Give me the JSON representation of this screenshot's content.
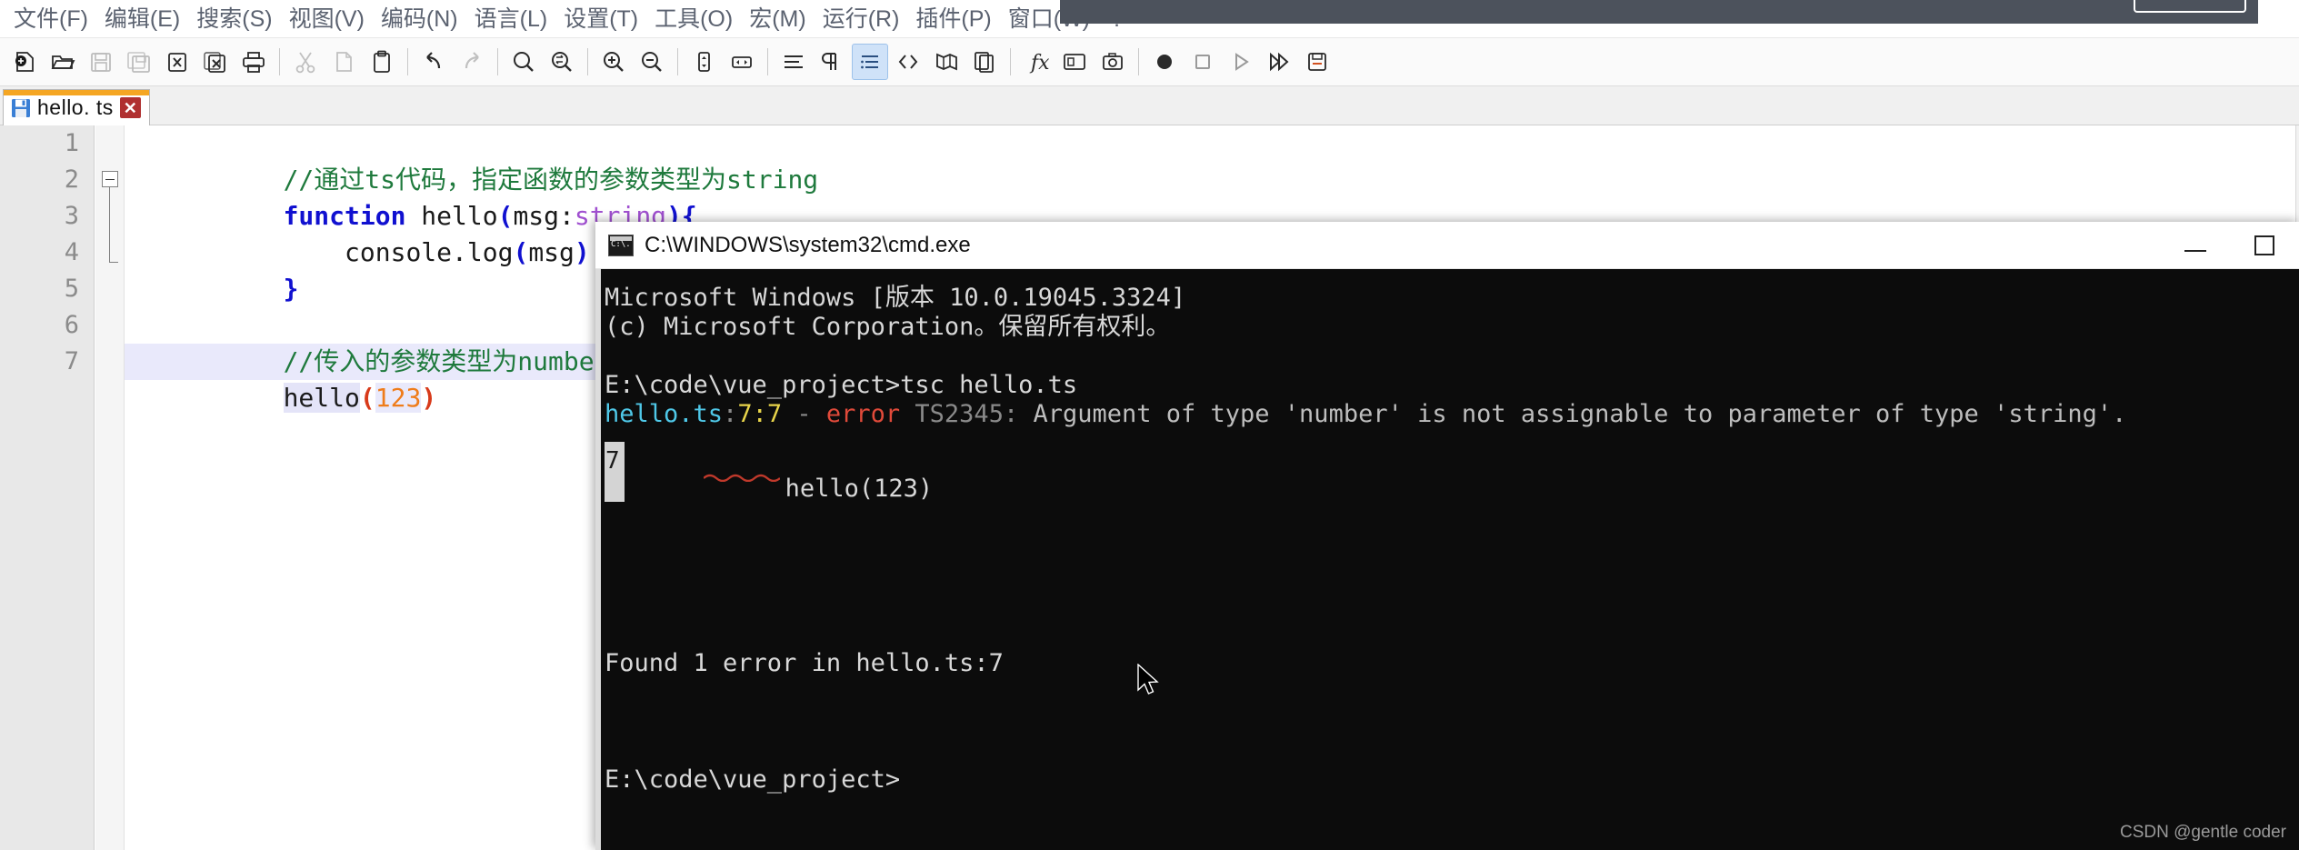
{
  "app": {
    "name": "Notepad++",
    "menu": [
      {
        "label": "文件(F)",
        "name": "menu-file"
      },
      {
        "label": "编辑(E)",
        "name": "menu-edit"
      },
      {
        "label": "搜索(S)",
        "name": "menu-search"
      },
      {
        "label": "视图(V)",
        "name": "menu-view"
      },
      {
        "label": "编码(N)",
        "name": "menu-encoding"
      },
      {
        "label": "语言(L)",
        "name": "menu-language"
      },
      {
        "label": "设置(T)",
        "name": "menu-settings"
      },
      {
        "label": "工具(O)",
        "name": "menu-tools"
      },
      {
        "label": "宏(M)",
        "name": "menu-macro"
      },
      {
        "label": "运行(R)",
        "name": "menu-run"
      },
      {
        "label": "插件(P)",
        "name": "menu-plugins"
      },
      {
        "label": "窗口(W)",
        "name": "menu-window"
      },
      {
        "label": "?",
        "name": "menu-help"
      }
    ],
    "toolbar": [
      {
        "icon": "new-file-icon",
        "label": "新建"
      },
      {
        "icon": "open-folder-icon",
        "label": "打开"
      },
      {
        "icon": "save-icon",
        "label": "保存"
      },
      {
        "icon": "save-all-icon",
        "label": "保存所有"
      },
      {
        "icon": "close-file-icon",
        "label": "关闭"
      },
      {
        "icon": "close-all-icon",
        "label": "关闭所有"
      },
      {
        "icon": "print-icon",
        "label": "打印"
      },
      {
        "icon": "cut-icon",
        "label": "剪切"
      },
      {
        "icon": "copy-icon",
        "label": "复制"
      },
      {
        "icon": "paste-icon",
        "label": "粘贴"
      },
      {
        "icon": "undo-icon",
        "label": "撤销"
      },
      {
        "icon": "redo-icon",
        "label": "重做"
      },
      {
        "icon": "find-icon",
        "label": "查找"
      },
      {
        "icon": "replace-icon",
        "label": "替换"
      },
      {
        "icon": "zoom-in-icon",
        "label": "放大"
      },
      {
        "icon": "zoom-out-icon",
        "label": "缩小"
      },
      {
        "icon": "sync-vertical-icon",
        "label": "垂直同步滚动"
      },
      {
        "icon": "sync-horizontal-icon",
        "label": "水平同步滚动"
      },
      {
        "icon": "word-wrap-icon",
        "label": "自动换行"
      },
      {
        "icon": "show-all-chars-icon",
        "label": "显示所有字符"
      },
      {
        "icon": "indent-guide-icon",
        "label": "显示缩进参考线"
      },
      {
        "icon": "show-tag-icon",
        "label": "用户自定义工具栏"
      },
      {
        "icon": "doc-map-icon",
        "label": "文档映射"
      },
      {
        "icon": "doc-list-icon",
        "label": "文档列表"
      },
      {
        "icon": "function-list-icon",
        "label": "函数列表"
      },
      {
        "icon": "folder-workspace-icon",
        "label": "文件夹作为工作区"
      },
      {
        "icon": "monitoring-icon",
        "label": "监视文档"
      },
      {
        "icon": "record-macro-icon",
        "label": "录制宏"
      },
      {
        "icon": "stop-macro-icon",
        "label": "停止录制"
      },
      {
        "icon": "play-macro-icon",
        "label": "回放宏"
      },
      {
        "icon": "play-multiple-icon",
        "label": "多次运行宏"
      },
      {
        "icon": "save-macro-icon",
        "label": "保存当前录制的宏"
      }
    ],
    "tab": {
      "label": "hello. ts",
      "save_icon": "floppy-save-icon",
      "close_icon": "close-tab-icon"
    }
  },
  "editor": {
    "gutter_numbers": [
      "1",
      "2",
      "3",
      "4",
      "5",
      "6",
      "7"
    ],
    "lines": [
      {
        "n": 1,
        "type": "comment",
        "text": "//通过ts代码，指定函数的参数类型为string"
      },
      {
        "n": 2,
        "type": "function-decl",
        "kw": "function",
        "name": " hello",
        "paren_open": "(",
        "param": "msg:",
        "ptype": "string",
        "paren_close": ")",
        "brace": "{"
      },
      {
        "n": 3,
        "type": "call",
        "text": "    console.log",
        "paren_open": "(",
        "arg": "msg",
        "paren_close": ")"
      },
      {
        "n": 4,
        "type": "brace",
        "text": "}"
      },
      {
        "n": 5,
        "type": "blank",
        "text": ""
      },
      {
        "n": 6,
        "type": "comment",
        "text": "//传入的参数类型为number"
      },
      {
        "n": 7,
        "type": "call-current",
        "name": "hello",
        "paren_open": "(",
        "arg": "123",
        "paren_close": ")"
      }
    ]
  },
  "cmd": {
    "title": "C:\\WINDOWS\\system32\\cmd.exe",
    "icon": "cmd-console-icon",
    "controls": {
      "minimize": "minimize-button",
      "maximize": "maximize-button"
    },
    "lines": [
      {
        "kind": "plain",
        "text": "Microsoft Windows [版本 10.0.19045.3324]"
      },
      {
        "kind": "plain",
        "text": "(c) Microsoft Corporation。保留所有权利。"
      },
      {
        "kind": "blank",
        "text": ""
      },
      {
        "kind": "prompt",
        "prompt": "E:\\code\\vue_project>",
        "command": "tsc hello.ts"
      },
      {
        "kind": "error",
        "file": "hello.ts",
        "sep1": ":",
        "pos": "7:7",
        "dash": " - ",
        "errword": "error",
        "code": " TS2345:",
        "message": " Argument of type 'number' is not assignable to parameter of type 'string'."
      },
      {
        "kind": "snippet",
        "line_no": "7",
        "code": "hello(123)"
      },
      {
        "kind": "blank",
        "text": ""
      },
      {
        "kind": "summary",
        "text": "Found 1 error in hello.ts:7"
      },
      {
        "kind": "blank",
        "text": ""
      },
      {
        "kind": "blank",
        "text": ""
      },
      {
        "kind": "prompt-final",
        "prompt": "E:\\code\\vue_project>"
      }
    ]
  },
  "watermark": "CSDN @gentle coder",
  "colors": {
    "tab_accent": "#f5a623",
    "comment_green": "#1f7a3d",
    "keyword_blue": "#1010d0",
    "type_purple": "#a050d0",
    "number_orange": "#ef7c1a",
    "paren_red": "#d83a1a",
    "terminal_bg": "#0c0c0c",
    "error_red": "#e04a3a",
    "file_cyan": "#4fc8e8",
    "pos_yellow": "#e8d44a"
  }
}
